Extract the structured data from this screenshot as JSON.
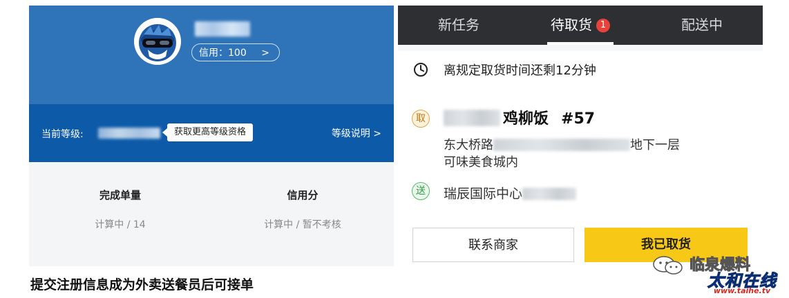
{
  "profile": {
    "credit_label": "信用：100",
    "credit_arrow": ">",
    "level_label": "当前等级:",
    "upgrade_tip": "获取更高等级资格",
    "level_explain": "等级说明 >"
  },
  "stats": [
    {
      "title": "完成单量",
      "value": "计算中 / 14"
    },
    {
      "title": "信用分",
      "value": "计算中 / 暂不考核"
    }
  ],
  "caption": "提交注册信息成为外卖送餐员后可接单",
  "tabs": [
    {
      "label": "新任务"
    },
    {
      "label": "待取货",
      "badge": "1"
    },
    {
      "label": "配送中"
    }
  ],
  "order": {
    "timer_text": "离规定取货时间还剩12分钟",
    "pickup_tag": "取",
    "dish": "鸡柳饭",
    "order_number": "#57",
    "address_prefix": "东大桥路",
    "address_suffix": "地下一层",
    "address_line2": "可味美食城内",
    "delivery_tag": "送",
    "destination": "瑞辰国际中心"
  },
  "actions": {
    "contact_label": "联系商家",
    "picked_label": "我已取货"
  },
  "watermark": {
    "wechat_text": "临泉爆料",
    "site_name": "太和在线",
    "site_url": "www.taihe.tv"
  },
  "colors": {
    "profile_blue": "#2f74b8",
    "level_blue": "#0d5aa8",
    "tabbar_dark": "#2d2f33",
    "badge_red": "#e8433a",
    "button_yellow": "#f7c816"
  }
}
